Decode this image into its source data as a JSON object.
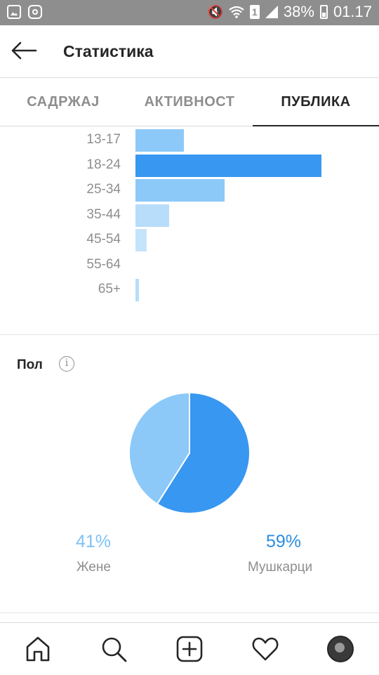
{
  "status_bar": {
    "battery": "38%",
    "time": "01.17",
    "sim": "1",
    "icons": [
      "gallery-icon",
      "instagram-icon",
      "mute-icon",
      "wifi-icon",
      "signal-icon",
      "battery-icon"
    ]
  },
  "header": {
    "title": "Статистика",
    "back_icon": "back-arrow-icon"
  },
  "tabs": [
    {
      "label": "САДРЖАЈ",
      "active": false
    },
    {
      "label": "АКТИВНОСТ",
      "active": false
    },
    {
      "label": "ПУБЛИКА",
      "active": true
    }
  ],
  "chart_data": [
    {
      "type": "bar",
      "orientation": "horizontal",
      "categories": [
        "13-17",
        "18-24",
        "25-34",
        "35-44",
        "45-54",
        "55-64",
        "65+"
      ],
      "values": [
        26,
        100,
        48,
        18,
        6,
        0,
        2
      ],
      "colors": [
        "#8cc9f8",
        "#3897f0",
        "#8cc9f8",
        "#b8ddfa",
        "#c5e3fb",
        "#cfe8fc",
        "#b8ddfa"
      ]
    },
    {
      "type": "pie",
      "title": "Пол",
      "categories": [
        "Жене",
        "Мушкарци"
      ],
      "values": [
        41,
        59
      ],
      "value_labels": [
        "41%",
        "59%"
      ],
      "colors": [
        "#8cc9f8",
        "#3897f0"
      ]
    }
  ],
  "bottom_nav": {
    "items": [
      "home-icon",
      "search-icon",
      "add-post-icon",
      "activity-heart-icon",
      "profile-avatar"
    ]
  },
  "colors": {
    "accent": "#3897f0",
    "light_accent": "#8cc9f8",
    "status_bar": "#8e8e8e"
  }
}
